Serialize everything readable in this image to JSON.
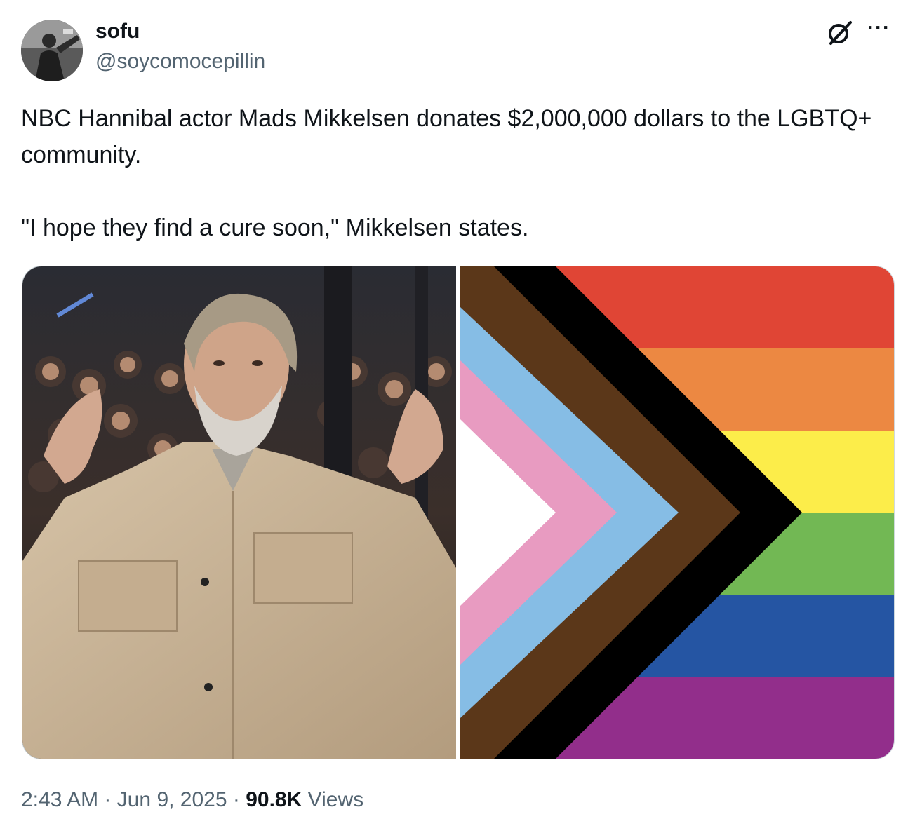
{
  "author": {
    "display_name": "sofu",
    "handle": "@soycomocepillin"
  },
  "header_icons": {
    "grok": "grok-icon",
    "more": "more-icon",
    "more_glyph": "···"
  },
  "tweet": {
    "text": "NBC Hannibal actor Mads Mikkelsen donates $2,000,000 dollars to the LGBTQ+ community.\n\n\"I hope they find a cure soon,\" Mikkelsen states."
  },
  "media": {
    "photo_description_icon": "photo-placeholder",
    "flag_colors": {
      "red": "#e04535",
      "orange": "#ec8842",
      "yellow": "#fced4a",
      "green": "#72b854",
      "blue": "#2555a3",
      "purple": "#922e8b",
      "black": "#000000",
      "brown": "#5b3719",
      "light_blue": "#86bde5",
      "pink": "#e89bc1",
      "white": "#ffffff"
    }
  },
  "meta": {
    "time": "2:43 AM",
    "separator": " · ",
    "date": "Jun 9, 2025",
    "views_count": "90.8K",
    "views_label": "Views"
  }
}
